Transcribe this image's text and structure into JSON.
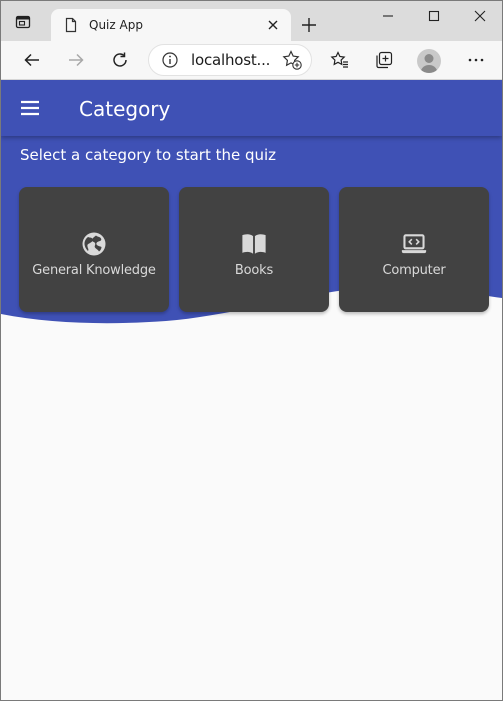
{
  "browser": {
    "tab_title": "Quiz App",
    "url": "localhost...",
    "accent_color": "#3f51b5"
  },
  "icons": {
    "tab_actions": "tab-actions-icon",
    "page": "page-icon",
    "tab_close": "close-icon",
    "new_tab": "plus-icon",
    "minimize": "minimize-icon",
    "maximize": "maximize-icon",
    "close_window": "close-icon",
    "back": "back-arrow-icon",
    "forward": "forward-arrow-icon",
    "refresh": "refresh-icon",
    "site_info": "info-icon",
    "add_favorite": "star-plus-icon",
    "favorites": "favorites-icon",
    "collections": "collections-icon",
    "profile": "avatar",
    "more": "more-icon"
  },
  "app": {
    "title": "Category",
    "subtitle": "Select a category to start the quiz",
    "categories": [
      {
        "label": "General Knowledge",
        "icon": "globe-icon"
      },
      {
        "label": "Books",
        "icon": "book-icon"
      },
      {
        "label": "Computer",
        "icon": "laptop-code-icon"
      }
    ],
    "colors": {
      "primary": "#3f51b5",
      "card": "#424242",
      "card_text": "#d9d9d9",
      "background": "#fafafa"
    }
  }
}
